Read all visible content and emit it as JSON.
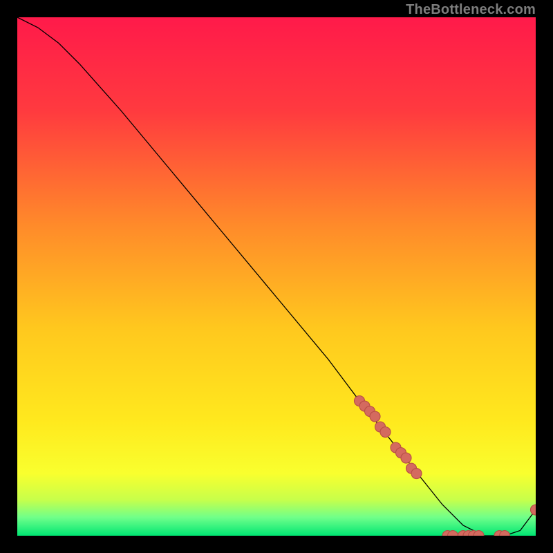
{
  "watermark": "TheBottleneck.com",
  "colors": {
    "gradient_stops": [
      {
        "offset": 0.0,
        "color": "#ff1a4a"
      },
      {
        "offset": 0.18,
        "color": "#ff3a3f"
      },
      {
        "offset": 0.4,
        "color": "#ff8a2a"
      },
      {
        "offset": 0.6,
        "color": "#ffc81e"
      },
      {
        "offset": 0.78,
        "color": "#ffe91e"
      },
      {
        "offset": 0.88,
        "color": "#f9ff2e"
      },
      {
        "offset": 0.93,
        "color": "#c8ff4a"
      },
      {
        "offset": 0.965,
        "color": "#6fff8a"
      },
      {
        "offset": 1.0,
        "color": "#00e673"
      }
    ],
    "curve": "#000000",
    "marker_fill": "#d46a5f",
    "marker_stroke": "#b84f46",
    "background": "#000000"
  },
  "chart_data": {
    "type": "line",
    "title": "",
    "xlabel": "",
    "ylabel": "",
    "xlim": [
      0,
      100
    ],
    "ylim": [
      0,
      100
    ],
    "note": "Axes are unlabeled; values are normalized 0-100 estimated from pixel positions.",
    "series": [
      {
        "name": "curve",
        "x": [
          0,
          4,
          8,
          12,
          20,
          30,
          40,
          50,
          60,
          66,
          70,
          74,
          78,
          82,
          86,
          90,
          94,
          97,
          100
        ],
        "y": [
          100,
          98,
          95,
          91,
          82,
          70,
          58,
          46,
          34,
          26,
          21,
          16,
          11,
          6,
          2,
          0,
          0,
          1,
          5
        ]
      }
    ],
    "markers": [
      {
        "x": 66,
        "y": 26
      },
      {
        "x": 67,
        "y": 25
      },
      {
        "x": 68,
        "y": 24
      },
      {
        "x": 69,
        "y": 23
      },
      {
        "x": 70,
        "y": 21
      },
      {
        "x": 71,
        "y": 20
      },
      {
        "x": 73,
        "y": 17
      },
      {
        "x": 74,
        "y": 16
      },
      {
        "x": 75,
        "y": 15
      },
      {
        "x": 76,
        "y": 13
      },
      {
        "x": 77,
        "y": 12
      },
      {
        "x": 83,
        "y": 0
      },
      {
        "x": 84,
        "y": 0
      },
      {
        "x": 86,
        "y": 0
      },
      {
        "x": 87,
        "y": 0
      },
      {
        "x": 88,
        "y": 0
      },
      {
        "x": 89,
        "y": 0
      },
      {
        "x": 93,
        "y": 0
      },
      {
        "x": 94,
        "y": 0
      },
      {
        "x": 100,
        "y": 5
      }
    ]
  }
}
